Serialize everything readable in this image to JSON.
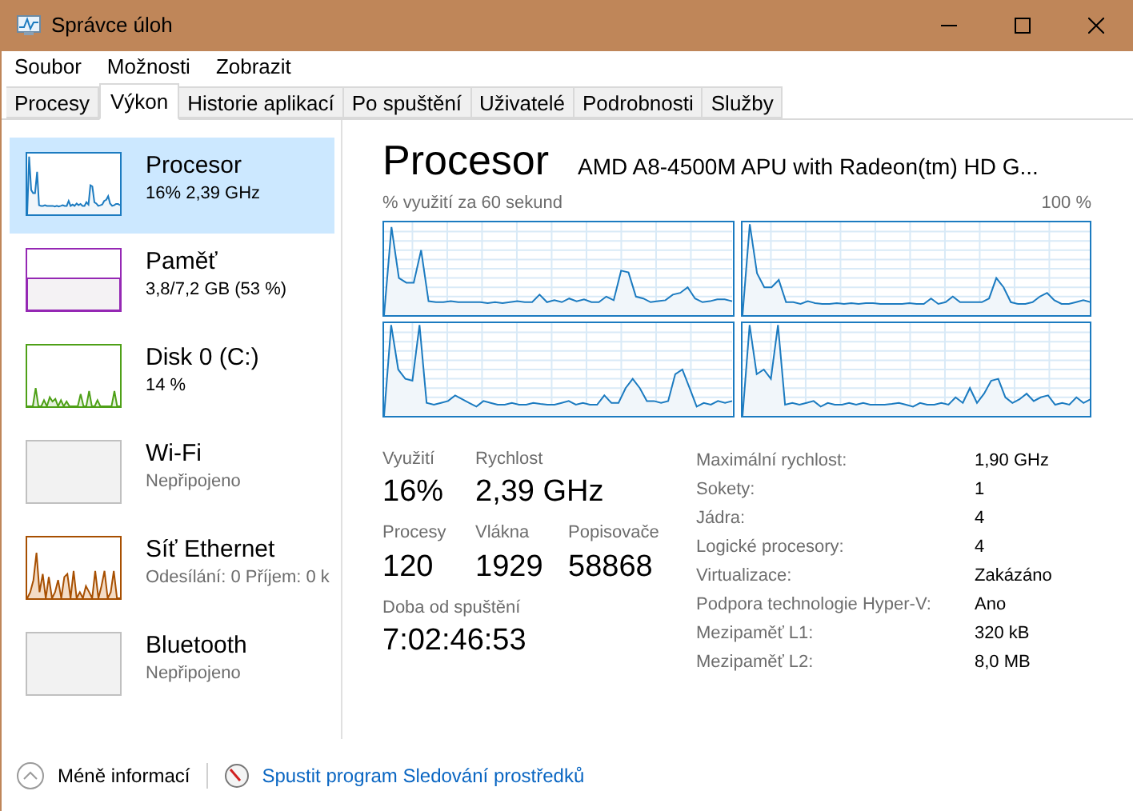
{
  "window": {
    "title": "Správce úloh"
  },
  "menu": [
    "Soubor",
    "Možnosti",
    "Zobrazit"
  ],
  "tabs": [
    {
      "label": "Procesy",
      "selected": false
    },
    {
      "label": "Výkon",
      "selected": true
    },
    {
      "label": "Historie aplikací",
      "selected": false
    },
    {
      "label": "Po spuštění",
      "selected": false
    },
    {
      "label": "Uživatelé",
      "selected": false
    },
    {
      "label": "Podrobnosti",
      "selected": false
    },
    {
      "label": "Služby",
      "selected": false
    }
  ],
  "sidebar": {
    "items": [
      {
        "kind": "cpu",
        "name": "Procesor",
        "detail": "16% 2,39 GHz",
        "color": "#1c7bc0",
        "selected": true,
        "dimmed": false
      },
      {
        "kind": "memory",
        "name": "Paměť",
        "detail": "3,8/7,2 GB (53 %)",
        "color": "#9528b4",
        "selected": false,
        "dimmed": false
      },
      {
        "kind": "disk",
        "name": "Disk 0 (C:)",
        "detail": "14 %",
        "color": "#4ea017",
        "selected": false,
        "dimmed": false
      },
      {
        "kind": "none",
        "name": "Wi-Fi",
        "detail": "Nepřipojeno",
        "color": "#c0c0c0",
        "selected": false,
        "dimmed": true
      },
      {
        "kind": "network",
        "name": "Síť Ethernet",
        "detail": "Odesílání: 0 Příjem: 0 k",
        "color": "#a74f01",
        "selected": false,
        "dimmed": true
      },
      {
        "kind": "none",
        "name": "Bluetooth",
        "detail": "Nepřipojeno",
        "color": "#c0c0c0",
        "selected": false,
        "dimmed": true
      }
    ]
  },
  "panel": {
    "title": "Procesor",
    "model": "AMD A8-4500M APU with Radeon(tm) HD G...",
    "graph_caption": "% využití za 60 sekund",
    "graph_max": "100 %",
    "stats_rows": [
      [
        {
          "label": "Využití",
          "value": "16%"
        },
        {
          "label": "Rychlost",
          "value": "2,39 GHz"
        }
      ],
      [
        {
          "label": "Procesy",
          "value": "120"
        },
        {
          "label": "Vlákna",
          "value": "1929"
        },
        {
          "label": "Popisovače",
          "value": "58868"
        }
      ],
      [
        {
          "label": "Doba od spuštění",
          "value": "7:02:46:53"
        }
      ]
    ],
    "details": [
      {
        "label": "Maximální rychlost:",
        "value": "1,90 GHz"
      },
      {
        "label": "Sokety:",
        "value": "1"
      },
      {
        "label": "Jádra:",
        "value": "4"
      },
      {
        "label": "Logické procesory:",
        "value": "4"
      },
      {
        "label": "Virtualizace:",
        "value": "Zakázáno"
      },
      {
        "label": "Podpora technologie Hyper-V:",
        "value": "Ano"
      },
      {
        "label": "Mezipaměť L1:",
        "value": "320 kB"
      },
      {
        "label": "Mezipaměť L2:",
        "value": "8,0 MB"
      }
    ]
  },
  "footer": {
    "less_info": "Méně informací",
    "monitor_link": "Spustit program Sledování prostředků"
  }
}
